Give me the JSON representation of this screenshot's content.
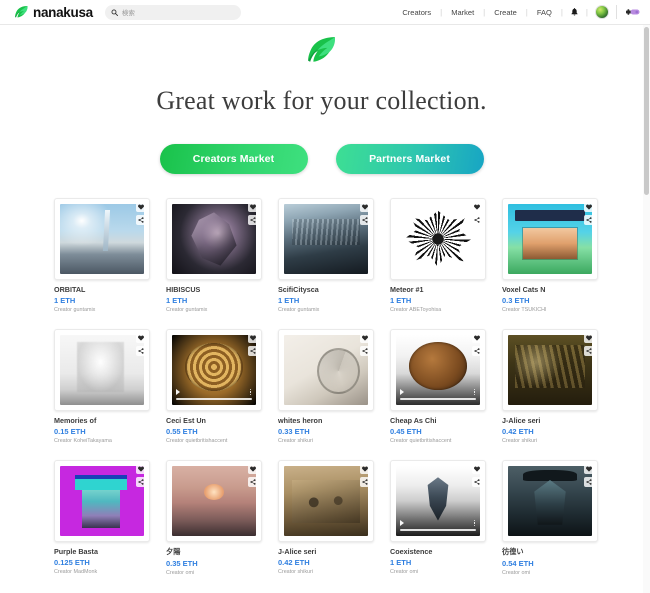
{
  "header": {
    "brand_name": "nanakusa",
    "brand_logo_icon": "leaf-logo-icon",
    "search": {
      "placeholder": "検索",
      "value": "",
      "icon": "search-icon"
    },
    "nav_links": [
      {
        "label": "Creators"
      },
      {
        "label": "Market"
      },
      {
        "label": "Create"
      },
      {
        "label": "FAQ"
      }
    ],
    "separator": "|",
    "notification_icon": "bell-icon",
    "avatar_icon": "avatar",
    "wallet_icon": "wallet-connect-icon"
  },
  "hero": {
    "logo_icon": "leaf-logo-icon",
    "title": "Great work for your collection.",
    "buttons": [
      {
        "label": "Creators Market",
        "color": "#1fcb55"
      },
      {
        "label": "Partners Market",
        "color": "#2ec5b0"
      }
    ]
  },
  "card_actions": {
    "like_icon": "heart-icon",
    "share_icon": "share-icon"
  },
  "creator_prefix": "Creator",
  "items": [
    {
      "title": "ORBITAL",
      "price": "1 ETH",
      "creator": "Creator guntamix",
      "art": "art-orbital",
      "media": "image"
    },
    {
      "title": "HIBISCUS",
      "price": "1 ETH",
      "creator": "Creator guntamix",
      "art": "art-hibiscus",
      "media": "image"
    },
    {
      "title": "ScifiCitysca",
      "price": "1 ETH",
      "creator": "Creator guntamix",
      "art": "art-scifi",
      "media": "image"
    },
    {
      "title": "Meteor #1",
      "price": "1 ETH",
      "creator": "Creator ABEToyohisa",
      "art": "art-meteor",
      "media": "image"
    },
    {
      "title": "Voxel Cats N",
      "price": "0.3 ETH",
      "creator": "Creator TSUKICHI",
      "art": "art-voxel",
      "media": "image"
    },
    {
      "title": "Memories of",
      "price": "0.15 ETH",
      "creator": "Creator KoheiTakayama",
      "art": "art-memories",
      "media": "image"
    },
    {
      "title": "Ceci Est Un",
      "price": "0.55 ETH",
      "creator": "Creator quietbritishaccent",
      "art": "art-ceci",
      "media": "video"
    },
    {
      "title": "whites heron",
      "price": "0.33 ETH",
      "creator": "Creator shikuri",
      "art": "art-heron",
      "media": "image"
    },
    {
      "title": "Cheap As Chi",
      "price": "0.45 ETH",
      "creator": "Creator quietbritishaccent",
      "art": "art-cheap",
      "media": "video"
    },
    {
      "title": "J-Alice seri",
      "price": "0.42 ETH",
      "creator": "Creator shikuri",
      "art": "art-jalice1",
      "media": "image"
    },
    {
      "title": "Purple Basta",
      "price": "0.125 ETH",
      "creator": "Creator MadMonk",
      "art": "art-punk",
      "media": "image"
    },
    {
      "title": "夕陽",
      "price": "0.35 ETH",
      "creator": "Creator omi",
      "art": "art-yuuhi",
      "media": "image"
    },
    {
      "title": "J-Alice seri",
      "price": "0.42 ETH",
      "creator": "Creator shikuri",
      "art": "art-jalice2",
      "media": "image"
    },
    {
      "title": "Coexistence",
      "price": "1 ETH",
      "creator": "Creator omi",
      "art": "art-coex",
      "media": "video"
    },
    {
      "title": "彷徨い",
      "price": "0.54 ETH",
      "creator": "Creator omi",
      "art": "art-samayoi",
      "media": "image"
    }
  ]
}
